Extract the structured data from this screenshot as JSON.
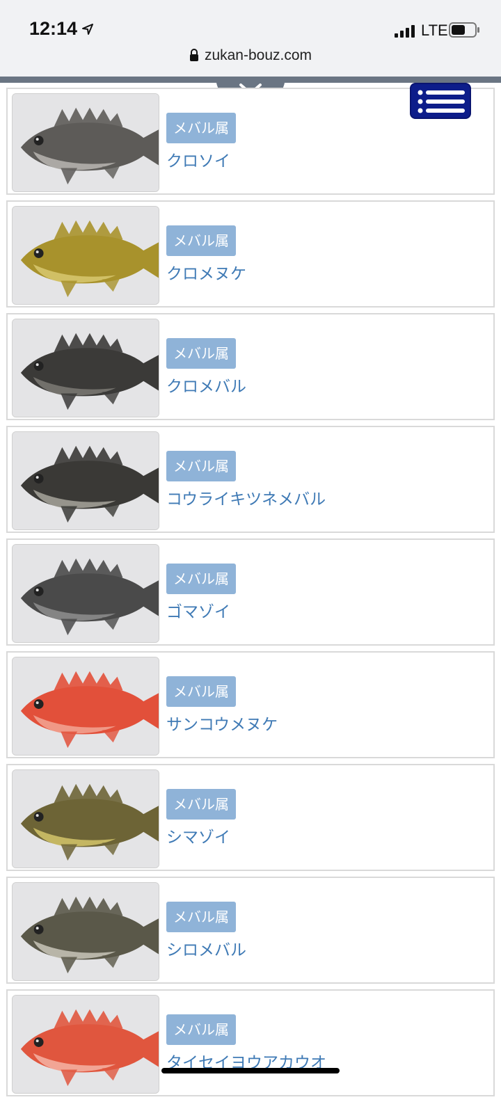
{
  "status": {
    "time": "12:14",
    "carrier": "LTE"
  },
  "browser": {
    "url": "zukan-bouz.com"
  },
  "icons": {
    "location": "location-arrow-icon",
    "signal": "signal-icon",
    "battery": "battery-icon",
    "lock": "lock-icon",
    "chevron": "chevron-down-icon",
    "menu": "menu-list-icon"
  },
  "colors": {
    "tag_bg": "#8fb3d8",
    "link": "#3f7ab5",
    "menu_bg": "#0d1d8a",
    "header_strip": "#6a7583"
  },
  "fish_list": [
    {
      "genus": "メバル属",
      "name": "クロソイ",
      "fish_color": "#5d5b58",
      "belly_color": "#b8b6b2"
    },
    {
      "genus": "メバル属",
      "name": "クロメヌケ",
      "fish_color": "#a8922c",
      "belly_color": "#d8c870"
    },
    {
      "genus": "メバル属",
      "name": "クロメバル",
      "fish_color": "#3b3a38",
      "belly_color": "#7c7a74"
    },
    {
      "genus": "メバル属",
      "name": "コウライキツネメバル",
      "fish_color": "#3a3936",
      "belly_color": "#a7a49b"
    },
    {
      "genus": "メバル属",
      "name": "ゴマゾイ",
      "fish_color": "#4a4a4a",
      "belly_color": "#8e8e8e"
    },
    {
      "genus": "メバル属",
      "name": "サンコウメヌケ",
      "fish_color": "#e2503a",
      "belly_color": "#f2a594"
    },
    {
      "genus": "メバル属",
      "name": "シマゾイ",
      "fish_color": "#6d6436",
      "belly_color": "#d4c46a"
    },
    {
      "genus": "メバル属",
      "name": "シロメバル",
      "fish_color": "#5a5849",
      "belly_color": "#c9c6b8"
    },
    {
      "genus": "メバル属",
      "name": "タイセイヨウアカウオ",
      "fish_color": "#e0563e",
      "belly_color": "#f4b3a4"
    }
  ]
}
